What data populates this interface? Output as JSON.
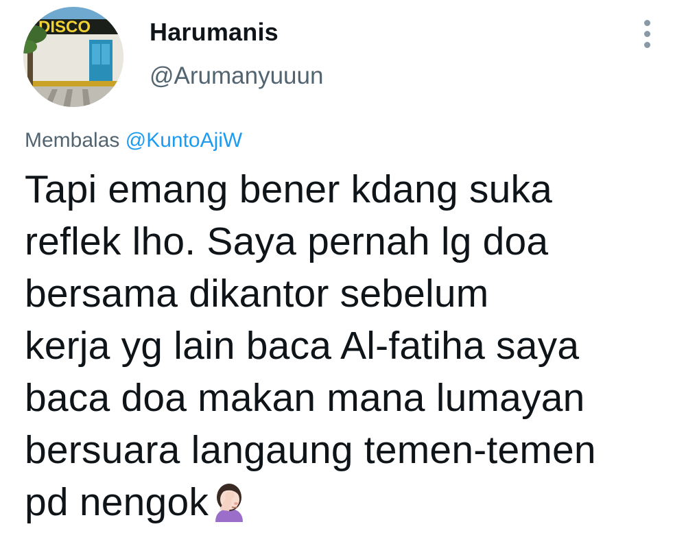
{
  "tweet": {
    "author": {
      "display_name": "Harumanis",
      "handle": "@Arumanyuuun",
      "avatar_sign_text": "DISCO"
    },
    "more_icon": "more-dots-icon",
    "replying_to": {
      "prefix": "Membalas",
      "mention": "@KuntoAjiW"
    },
    "text_lines": [
      "Tapi emang bener kdang suka",
      "reflek lho. Saya pernah lg doa",
      "bersama dikantor sebelum",
      "kerja yg lain baca Al-fatiha saya",
      "baca doa makan mana lumayan",
      "bersuara langaung temen-temen",
      "pd nengok"
    ],
    "trailing_emoji": "woman-facepalming-emoji"
  },
  "colors": {
    "text_primary": "#0f1419",
    "text_secondary": "#536471",
    "link": "#1d9bf0"
  }
}
